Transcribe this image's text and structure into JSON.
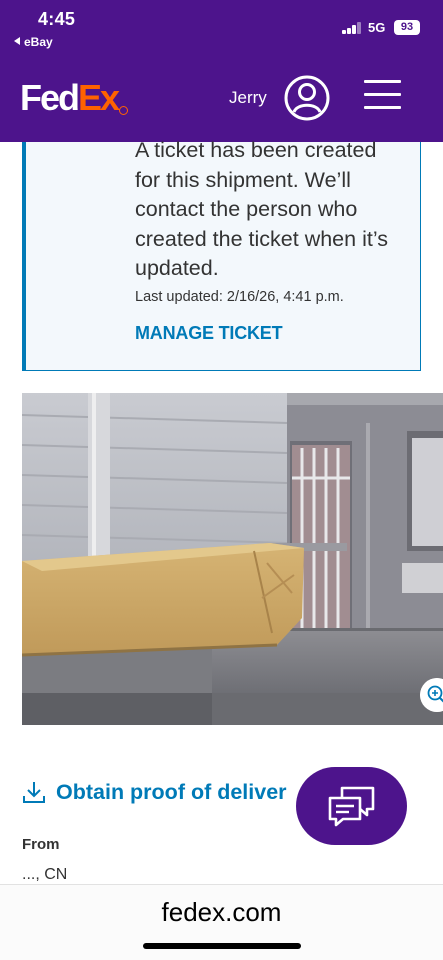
{
  "status_bar": {
    "time": "4:45",
    "back_app": "eBay",
    "network": "5G",
    "battery": "93"
  },
  "header": {
    "logo_fed": "Fed",
    "logo_ex": "Ex",
    "user_name": "Jerry",
    "brand_purple": "#4d148c",
    "brand_orange": "#ff6200"
  },
  "ticket": {
    "message": "A ticket has been created for this shipment. We’ll contact the person who created the ticket when it’s updated.",
    "last_updated": "Last updated: 2/16/26, 4:41 p.m.",
    "manage_label": "MANAGE TICKET"
  },
  "delivery_photo": {
    "zoom_icon": "zoom-in-icon"
  },
  "proof": {
    "label": "Obtain proof of deliver",
    "icon": "download-icon"
  },
  "chat": {
    "icon": "chat-bubbles-icon"
  },
  "shipment": {
    "from_label": "From",
    "from_value": "..., CN"
  },
  "browser": {
    "url": "fedex.com"
  },
  "colors": {
    "link_blue": "#007ab7",
    "ticket_bg": "#f3f8fc"
  }
}
